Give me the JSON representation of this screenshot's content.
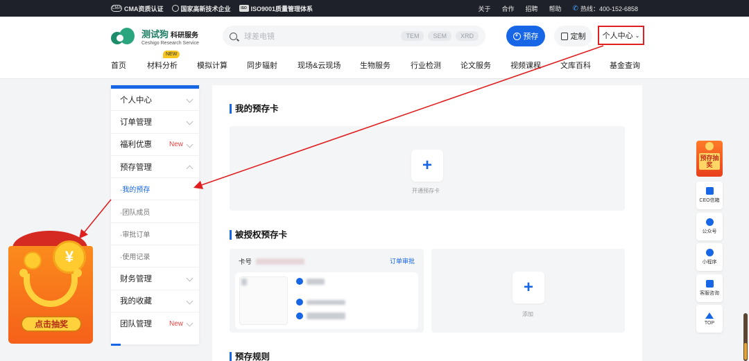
{
  "topbar": {
    "cert_cma": "CMA资质认证",
    "cert_cma_icon": "CMA",
    "cert_hightech": "国家高新技术企业",
    "cert_iso": "ISO9001质量管理体系",
    "cert_iso_icon": "ISO",
    "links": [
      "关于",
      "合作",
      "招聘",
      "帮助"
    ],
    "hotline": "热线：400-152-6858"
  },
  "header": {
    "logo_cn": "测试狗",
    "logo_sub_cn": "科研服务",
    "logo_en": "Ceshigo Research Service",
    "search_placeholder": "球差电镜",
    "search_tags": [
      "TEM",
      "SEM",
      "XRD"
    ],
    "btn_prestore": "预存",
    "btn_custom": "定制",
    "btn_user_center": "个人中心",
    "nav": [
      "首页",
      "材料分析",
      "模拟计算",
      "同步辐射",
      "现场&云现场",
      "生物服务",
      "行业检测",
      "论文服务",
      "视频课程",
      "文库百科",
      "基金查询"
    ],
    "nav_badge": "NEW"
  },
  "sidebar": {
    "items": [
      {
        "label": "个人中心"
      },
      {
        "label": "订单管理"
      },
      {
        "label": "福利优惠",
        "tag": "New"
      },
      {
        "label": "预存管理"
      },
      {
        "label": "·我的预存"
      },
      {
        "label": "·团队成员"
      },
      {
        "label": "·审批订单"
      },
      {
        "label": "·使用记录"
      },
      {
        "label": "财务管理"
      },
      {
        "label": "我的收藏"
      },
      {
        "label": "团队管理",
        "tag": "New"
      }
    ]
  },
  "main": {
    "sec1_title": "我的预存卡",
    "open_card_label": "开通预存卡",
    "sec2_title": "被授权预存卡",
    "card_no_label": "卡号",
    "order_review": "订单审批",
    "add_label": "添加",
    "sec3_title": "预存规则",
    "plus_glyph": "+"
  },
  "lottery": {
    "button": "点击抽奖",
    "coin": "¥"
  },
  "right_float": {
    "promo": "预存抽奖",
    "items": [
      "CEO信箱",
      "公众号",
      "小程序",
      "客服咨询",
      "TOP"
    ]
  },
  "colors": {
    "accent": "#1766e6",
    "alert": "#e02020",
    "new_tag": "#f04040"
  }
}
